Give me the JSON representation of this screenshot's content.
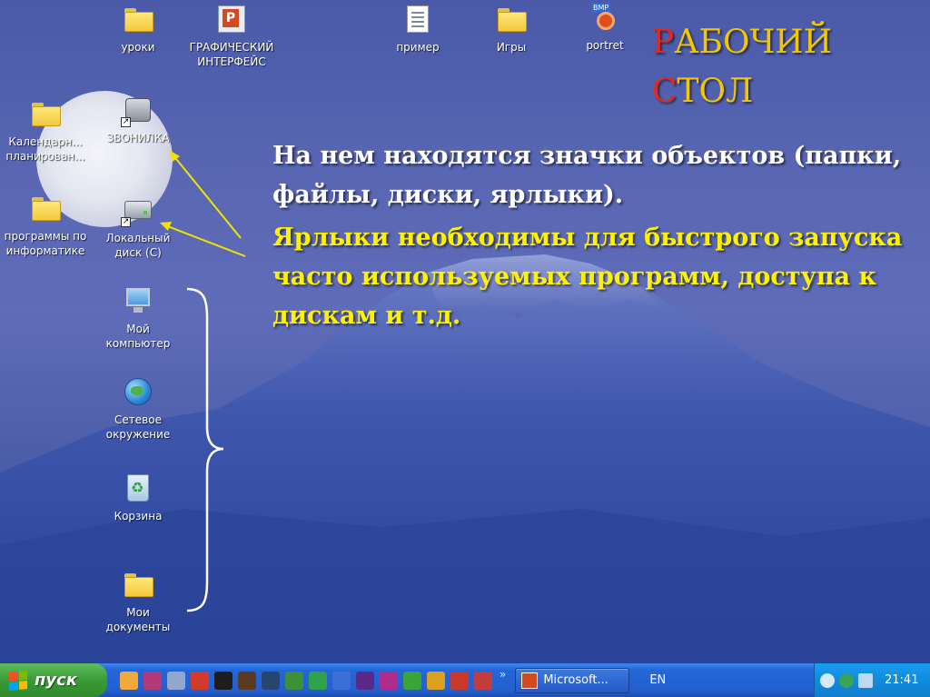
{
  "title": {
    "line1": "РАБОЧИЙ",
    "line2": "СТОЛ"
  },
  "description": {
    "text1": "На нем находятся значки объектов (папки, файлы, диски, ярлыки).",
    "text2": "Ярлыки необходимы для быстрого запуска часто используемых программ, доступа к дискам и т.д."
  },
  "desktop_icons": {
    "uroki": "уроки",
    "graf": "ГРАФИЧЕСКИЙ ИНТЕРФЕЙС",
    "primer": "пример",
    "igry": "Игры",
    "portret": "portret",
    "calendar": "Календарн... планирован...",
    "zvonilka": "ЗВОНИЛКА",
    "programmy": "программы по информатике",
    "local_disk": "Локальный диск (C)",
    "my_computer": "Мой компьютер",
    "network": "Сетевое окружение",
    "recycle": "Корзина",
    "my_docs": "Мои документы"
  },
  "taskbar": {
    "start_label": "пуск",
    "chevrons": "»",
    "task_label": "Microsoft...",
    "language": "EN",
    "clock": "21:41"
  },
  "colors": {
    "title_main": "#f2c600",
    "title_first_letter": "#e8261a",
    "desc_white": "#ffffff",
    "desc_yellow": "#fff200",
    "arrow": "#f2e200"
  }
}
